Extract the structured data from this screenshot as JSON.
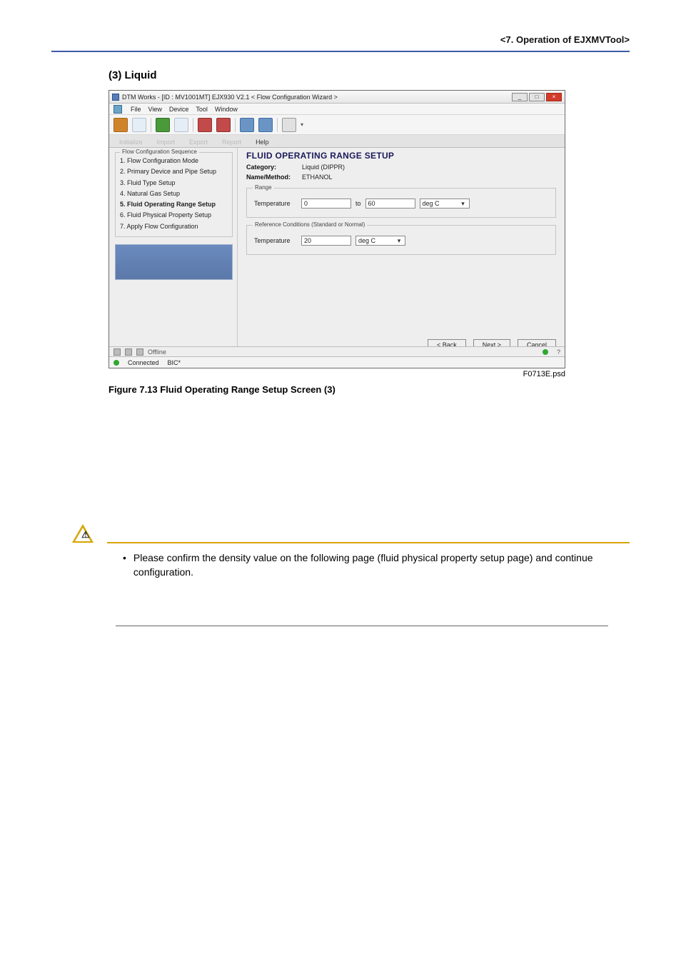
{
  "header": {
    "chapter": "<7.  Operation of EJXMVTool>"
  },
  "section": {
    "heading": "(3)   Liquid"
  },
  "screenshot": {
    "titlebar": "DTM Works - [ID : MV1001MT] EJX930 V2.1 < Flow Configuration Wizard >",
    "menubar": [
      "File",
      "View",
      "Device",
      "Tool",
      "Window"
    ],
    "toolbar_tabs": {
      "inactive": [
        "Initialize",
        "Import",
        "Export",
        "Report"
      ],
      "active": "Help"
    },
    "sidebar": {
      "legend": "Flow Configuration Sequence",
      "items": [
        "1. Flow Configuration Mode",
        "2. Primary Device and Pipe Setup",
        "3. Fluid Type Setup",
        "4. Natural Gas Setup",
        "5. Fluid Operating Range Setup",
        "6. Fluid Physical Property Setup",
        "7. Apply Flow Configuration"
      ],
      "active_index": 4
    },
    "main": {
      "title": "FLUID OPERATING RANGE SETUP",
      "category_label": "Category:",
      "category_value": "Liquid (DIPPR)",
      "name_label": "Name/Method:",
      "name_value": "ETHANOL",
      "group_range": {
        "legend": "Range",
        "temperature_label": "Temperature",
        "from": "0",
        "to_label": "to",
        "to": "60",
        "unit": "deg C"
      },
      "group_ref": {
        "legend": "Reference Conditions (Standard or Normal)",
        "temperature_label": "Temperature",
        "value": "20",
        "unit": "deg C"
      },
      "buttons": {
        "back": "< Back",
        "next": "Next >",
        "cancel": "Cancel"
      }
    },
    "status": {
      "offline_label": "Offline",
      "connected": "Connected",
      "extra": "BIC*"
    },
    "filename": "F0713E.psd"
  },
  "figure_caption": "Figure 7.13     Fluid Operating Range Setup Screen (3)",
  "note": "Please confirm the density value on the following page (fluid physical property setup page) and continue configuration."
}
